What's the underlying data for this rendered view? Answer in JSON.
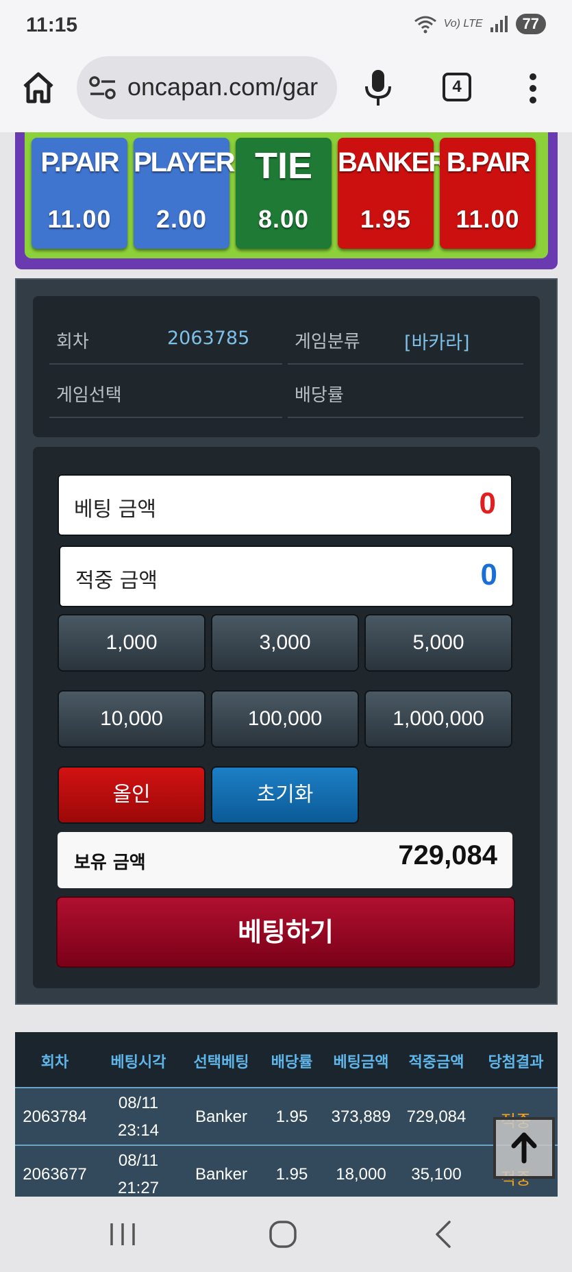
{
  "status_bar": {
    "time": "11:15",
    "network": "Vo) LTE",
    "battery": "77"
  },
  "browser": {
    "url": "oncapan.com/gar",
    "tab_count": "4"
  },
  "bet_board": [
    {
      "name": "P.PAIR",
      "odds": "11.00",
      "color": "#3f74cf"
    },
    {
      "name": "PLAYER",
      "odds": "2.00",
      "color": "#3f74cf"
    },
    {
      "name": "TIE",
      "odds": "8.00",
      "color": "#1e7a35"
    },
    {
      "name": "BANKER",
      "odds": "1.95",
      "color": "#cc1010"
    },
    {
      "name": "B.PAIR",
      "odds": "11.00",
      "color": "#cc1010"
    }
  ],
  "info": {
    "round_label": "회차",
    "round_value": "2063785",
    "category_label": "게임분류",
    "category_value": "[바카라]",
    "selection_label": "게임선택",
    "selection_value": "",
    "odds_label": "배당률",
    "odds_value": ""
  },
  "betting": {
    "bet_amount_label": "베팅 금액",
    "bet_amount_value": "0",
    "win_amount_label": "적중 금액",
    "win_amount_value": "0",
    "chips": [
      "1,000",
      "3,000",
      "5,000",
      "10,000",
      "100,000",
      "1,000,000"
    ],
    "allin_label": "올인",
    "reset_label": "초기화",
    "held_label": "보유 금액",
    "held_value": "729,084",
    "submit_label": "베팅하기"
  },
  "history": {
    "headers": [
      "회차",
      "베팅시각",
      "선택베팅",
      "배당률",
      "베팅금액",
      "적중금액",
      "당첨결과"
    ],
    "rows": [
      {
        "round": "2063784",
        "date": "08/11",
        "time": "23:14",
        "pick": "Banker",
        "odds": "1.95",
        "bet": "373,889",
        "win": "729,084",
        "result": "적중"
      },
      {
        "round": "2063677",
        "date": "08/11",
        "time": "21:27",
        "pick": "Banker",
        "odds": "1.95",
        "bet": "18,000",
        "win": "35,100",
        "result": "적중"
      }
    ]
  },
  "colors": {
    "accent_red": "#e02020",
    "accent_blue": "#1a6fd6",
    "header_text": "#5fb6ea",
    "result_text": "#f2a21c"
  }
}
